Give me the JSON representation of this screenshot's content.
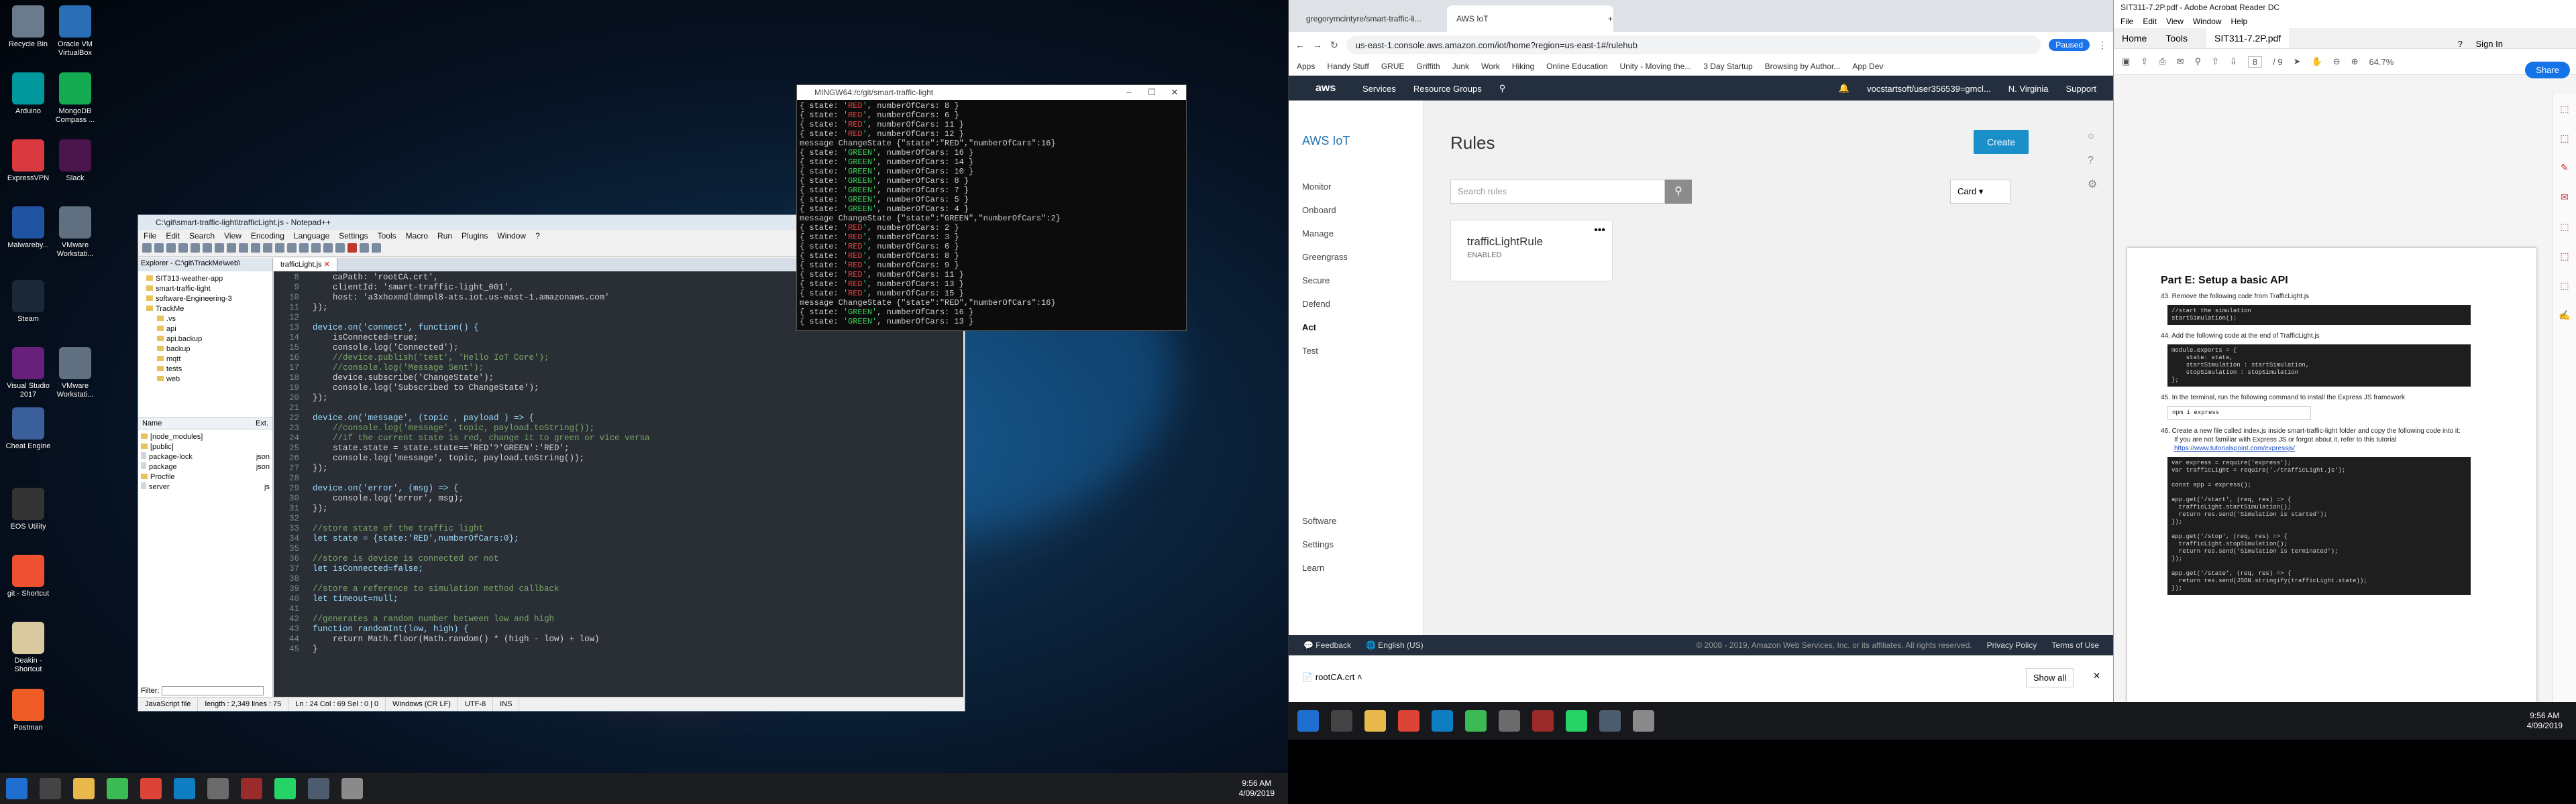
{
  "desktop_icons": [
    {
      "label": "Recycle Bin",
      "color": "#6b7b8c",
      "glyph": "trash-icon"
    },
    {
      "label": "Oracle VM VirtualBox",
      "color": "#2a6fb5",
      "glyph": "box-icon"
    },
    {
      "label": "Arduino",
      "color": "#00979d",
      "glyph": "infinity-icon"
    },
    {
      "label": "MongoDB Compass ...",
      "color": "#13aa52",
      "glyph": "leaf-icon"
    },
    {
      "label": "ExpressVPN",
      "color": "#da3940",
      "glyph": "shield-icon"
    },
    {
      "label": "Slack",
      "color": "#4a154b",
      "glyph": "hash-icon"
    },
    {
      "label": "Malwareby...",
      "color": "#2153a3",
      "glyph": "m-icon"
    },
    {
      "label": "VMware Workstati...",
      "color": "#607080",
      "glyph": "vm-icon"
    },
    {
      "label": "Steam",
      "color": "#1b2838",
      "glyph": "steam-icon"
    },
    {
      "label": "Visual Studio 2017",
      "color": "#68217a",
      "glyph": "vs-icon"
    },
    {
      "label": "VMware Workstati...",
      "color": "#607080",
      "glyph": "vm-icon"
    },
    {
      "label": "Cheat Engine",
      "color": "#3a5f9a",
      "glyph": "gear-icon"
    },
    {
      "label": "EOS Utility",
      "color": "#333",
      "glyph": "camera-icon"
    },
    {
      "label": "git - Shortcut",
      "color": "#f05032",
      "glyph": "git-icon"
    },
    {
      "label": "Deakin - Shortcut",
      "color": "#d8c9a0",
      "glyph": "folder-icon"
    },
    {
      "label": "Postman",
      "color": "#ef5b25",
      "glyph": "postman-icon"
    }
  ],
  "notepad": {
    "title": "C:\\git\\smart-traffic-light\\trafficLight.js - Notepad++",
    "menus": [
      "File",
      "Edit",
      "Search",
      "View",
      "Encoding",
      "Language",
      "Settings",
      "Tools",
      "Macro",
      "Run",
      "Plugins",
      "Window",
      "?"
    ],
    "explorer_path": "Explorer - C:\\git\\TrackMe\\web\\",
    "tree": [
      "SIT313-weather-app",
      "smart-traffic-light",
      "software-Engineering-3",
      "TrackMe",
      ".vs",
      "api",
      "api.backup",
      "backup",
      "mqtt",
      "tests",
      "web"
    ],
    "file_cols": [
      "Name",
      "Ext."
    ],
    "files": [
      [
        "[node_modules]",
        ""
      ],
      [
        "[public]",
        ""
      ],
      [
        "package-lock",
        "json"
      ],
      [
        "package",
        "json"
      ],
      [
        "Procfile",
        ""
      ],
      [
        "server",
        "js"
      ]
    ],
    "filter_label": "Filter:",
    "tab": "trafficLight.js",
    "code": [
      [
        "8",
        "    caPath: 'rootCA.crt',"
      ],
      [
        "9",
        "    clientId: 'smart-traffic-light_001',"
      ],
      [
        "10",
        "    host: 'a3xhoxmdldmnpl8-ats.iot.us-east-1.amazonaws.com'"
      ],
      [
        "11",
        "});"
      ],
      [
        "12",
        ""
      ],
      [
        "13",
        "device.on('connect', function() {"
      ],
      [
        "14",
        "    isConnected=true;"
      ],
      [
        "15",
        "    console.log('Connected');"
      ],
      [
        "16",
        "    //device.publish('test', 'Hello IoT Core');"
      ],
      [
        "17",
        "    //console.log('Message Sent');"
      ],
      [
        "18",
        "    device.subscribe('ChangeState');"
      ],
      [
        "19",
        "    console.log('Subscribed to ChangeState');"
      ],
      [
        "20",
        "});"
      ],
      [
        "21",
        ""
      ],
      [
        "22",
        "device.on('message', (topic , payload ) => {"
      ],
      [
        "23",
        "    //console.log('message', topic, payload.toString());"
      ],
      [
        "24",
        "    //if the current state is red, change it to green or vice versa"
      ],
      [
        "25",
        "    state.state = state.state=='RED'?'GREEN':'RED';"
      ],
      [
        "26",
        "    console.log('message', topic, payload.toString());"
      ],
      [
        "27",
        "});"
      ],
      [
        "28",
        ""
      ],
      [
        "29",
        "device.on('error', (msg) => {"
      ],
      [
        "30",
        "    console.log('error', msg);"
      ],
      [
        "31",
        "});"
      ],
      [
        "32",
        ""
      ],
      [
        "33",
        "//store state of the traffic light"
      ],
      [
        "34",
        "let state = {state:'RED',numberOfCars:0};"
      ],
      [
        "35",
        ""
      ],
      [
        "36",
        "//store is device is connected or not"
      ],
      [
        "37",
        "let isConnected=false;"
      ],
      [
        "38",
        ""
      ],
      [
        "39",
        "//store a reference to simulation method callback"
      ],
      [
        "40",
        "let timeout=null;"
      ],
      [
        "41",
        ""
      ],
      [
        "42",
        "//generates a random number between low and high"
      ],
      [
        "43",
        "function randomInt(low, high) {"
      ],
      [
        "44",
        "    return Math.floor(Math.random() * (high - low) + low)"
      ],
      [
        "45",
        "}"
      ]
    ],
    "status": [
      "JavaScript file",
      "length : 2,349    lines : 75",
      "Ln : 24    Col : 69    Sel : 0 | 0",
      "Windows (CR LF)",
      "UTF-8",
      "INS"
    ]
  },
  "console": {
    "title": "MINGW64:/c/git/smart-traffic-light",
    "lines": [
      [
        "{ state: ",
        "RED",
        ", numberOfCars: 8 }"
      ],
      [
        "{ state: ",
        "RED",
        ", numberOfCars: 6 }"
      ],
      [
        "{ state: ",
        "RED",
        ", numberOfCars: 11 }"
      ],
      [
        "{ state: ",
        "RED",
        ", numberOfCars: 12 }"
      ],
      [
        "message ChangeState {\"state\":\"RED\",\"numberOfCars\":16}",
        "",
        ""
      ],
      [
        "{ state: ",
        "GREEN",
        ", numberOfCars: 16 }"
      ],
      [
        "{ state: ",
        "GREEN",
        ", numberOfCars: 14 }"
      ],
      [
        "{ state: ",
        "GREEN",
        ", numberOfCars: 10 }"
      ],
      [
        "{ state: ",
        "GREEN",
        ", numberOfCars: 8 }"
      ],
      [
        "{ state: ",
        "GREEN",
        ", numberOfCars: 7 }"
      ],
      [
        "{ state: ",
        "GREEN",
        ", numberOfCars: 5 }"
      ],
      [
        "{ state: ",
        "GREEN",
        ", numberOfCars: 4 }"
      ],
      [
        "message ChangeState {\"state\":\"GREEN\",\"numberOfCars\":2}",
        "",
        ""
      ],
      [
        "{ state: ",
        "RED",
        ", numberOfCars: 2 }"
      ],
      [
        "{ state: ",
        "RED",
        ", numberOfCars: 3 }"
      ],
      [
        "{ state: ",
        "RED",
        ", numberOfCars: 6 }"
      ],
      [
        "{ state: ",
        "RED",
        ", numberOfCars: 8 }"
      ],
      [
        "{ state: ",
        "RED",
        ", numberOfCars: 9 }"
      ],
      [
        "{ state: ",
        "RED",
        ", numberOfCars: 11 }"
      ],
      [
        "{ state: ",
        "RED",
        ", numberOfCars: 13 }"
      ],
      [
        "{ state: ",
        "RED",
        ", numberOfCars: 15 }"
      ],
      [
        "message ChangeState {\"state\":\"RED\",\"numberOfCars\":16}",
        "",
        ""
      ],
      [
        "{ state: ",
        "GREEN",
        ", numberOfCars: 16 }"
      ],
      [
        "{ state: ",
        "GREEN",
        ", numberOfCars: 13 }"
      ]
    ]
  },
  "chrome": {
    "tabs": [
      "gregorymcintyre/smart-traffic-li...",
      "AWS IoT"
    ],
    "url": "us-east-1.console.aws.amazon.com/iot/home?region=us-east-1#/rulehub",
    "paused": "Paused",
    "bookmarks": [
      "Apps",
      "Handy Stuff",
      "GRUE",
      "Griffith",
      "Junk",
      "Work",
      "Hiking",
      "Online Education",
      "Unity - Moving the...",
      "3 Day Startup",
      "Browsing by Author...",
      "App Dev"
    ],
    "aws_nav": [
      "Services",
      "Resource Groups"
    ],
    "account": "vocstartsoft/user356539=gmcl...",
    "region": "N. Virginia",
    "support": "Support",
    "brand": "AWS IoT",
    "side_items": [
      "Monitor",
      "Onboard",
      "Manage",
      "Greengrass",
      "Secure",
      "Defend",
      "Act",
      "Test"
    ],
    "side_bottom": [
      "Software",
      "Settings",
      "Learn"
    ],
    "page_title": "Rules",
    "create": "Create",
    "search_placeholder": "Search rules",
    "view_select": "Card",
    "rule_name": "trafficLightRule",
    "rule_status": "ENABLED",
    "feedback": "Feedback",
    "language": "English (US)",
    "copyright": "© 2008 - 2019, Amazon Web Services, Inc. or its affiliates. All rights reserved.",
    "privacy": "Privacy Policy",
    "terms": "Terms of Use",
    "download": "rootCA.crt",
    "show_all": "Show all"
  },
  "acrobat": {
    "title": "SIT311-7.2P.pdf - Adobe Acrobat Reader DC",
    "menus": [
      "File",
      "Edit",
      "View",
      "Window",
      "Help"
    ],
    "tabs": [
      "Home",
      "Tools",
      "SIT311-7.2P.pdf"
    ],
    "page": "8",
    "page_total": "/ 9",
    "zoom": "64.7%",
    "signin": "Sign In",
    "share": "Share",
    "heading": "Part E: Setup a basic API",
    "steps": [
      "43. Remove the following code from TrafficLight.js",
      "44. Add the following code at the end of TrafficLight.js",
      "45. In the terminal, run the following command to install the Express JS framework",
      "46. Create a new file called index.js inside smart-traffic-light folder and copy the following code into it:",
      "If you are not familiar with Express JS or forgot about it, refer to this tutorial",
      "https://www.tutorialspoint.com/expressjs/"
    ],
    "code1": "//start the simulation\nstartSimulation();",
    "code2": "module.exports = {\n    state: state,\n    startSimulation : startSimulation,\n    stopSimulation : stopSimulation\n};",
    "code3": "npm i express",
    "code4": "var express = require('express');\nvar trafficLight = require('./trafficLight.js');\n\nconst app = express();\n\napp.get('/start', (req, res) => {\n  trafficLight.startSimulation();\n  return res.send('Simulation is started');\n});\n\napp.get('/stop', (req, res) => {\n  trafficLight.stopSimulation();\n  return res.send('Simulation is terminated');\n});\n\napp.get('/state', (req, res) => {\n  return res.send(JSON.stringify(trafficLight.state));\n});"
  },
  "taskbar_left": {
    "time": "9:56 AM",
    "date": "4/09/2019"
  },
  "taskbar_right": {
    "time": "9:56 AM",
    "date": "4/09/2019"
  }
}
